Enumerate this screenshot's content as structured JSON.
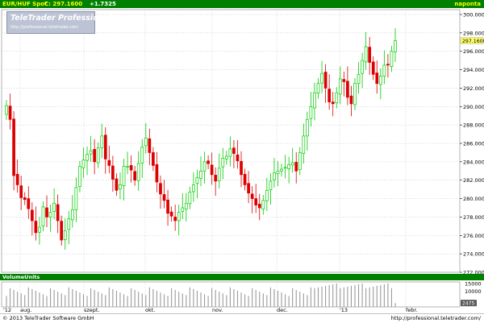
{
  "header": {
    "symbol": "EUR/HUF Spot",
    "close": "C: 297.1600",
    "change": "+1.7325",
    "period": "naponta"
  },
  "watermark": {
    "title": "TeleTrader Professional",
    "url": "http://professional.teletrader.com"
  },
  "volume_panel": {
    "title": "VolumeUnits",
    "ticks": [
      "15000",
      "10000"
    ],
    "last_label": "2475"
  },
  "footer": {
    "copyright": "© 2013 TeleTrader Software GmbH",
    "url": "http://professional.teletrader.com/"
  },
  "colors": {
    "up": "#00cc00",
    "down": "#dd0000",
    "header_bg": "#008000",
    "last_price_tag": "#ffff66",
    "grid": "#b0b0b0"
  },
  "chart_data": {
    "type": "candlestick",
    "title": "EUR/HUF Spot",
    "ylim": [
      272,
      300
    ],
    "yticks": [
      "300.0000",
      "298.0000",
      "296.0000",
      "294.0000",
      "292.0000",
      "290.0000",
      "288.0000",
      "286.0000",
      "284.0000",
      "282.0000",
      "280.0000",
      "278.0000",
      "276.0000",
      "274.0000",
      "272.0000"
    ],
    "last_price_label": "297.1600",
    "x_tick_labels": [
      "'12",
      "aug.",
      "szept.",
      "okt.",
      "nov.",
      "dec.",
      "'13",
      "febr."
    ],
    "grid": true,
    "close_series": [
      290.1,
      288.6,
      282.5,
      281.5,
      280.1,
      279.9,
      278.9,
      277.6,
      276.3,
      276.9,
      279.1,
      278.0,
      278.5,
      279.5,
      277.6,
      275.5,
      276.5,
      277.8,
      278.8,
      281.2,
      283.5,
      284.2,
      284.8,
      285.2,
      284.0,
      285.5,
      286.8,
      284.3,
      283.6,
      282.1,
      280.9,
      281.5,
      283.5,
      283.5,
      283.1,
      282.0,
      283.8,
      285.6,
      286.6,
      285.0,
      283.6,
      281.8,
      280.5,
      279.8,
      278.4,
      278.1,
      277.6,
      278.5,
      279.0,
      279.5,
      280.7,
      281.5,
      282.3,
      283.0,
      284.0,
      283.8,
      282.6,
      281.9,
      283.3,
      284.4,
      284.6,
      285.4,
      284.9,
      284.1,
      282.6,
      281.5,
      280.6,
      280.0,
      279.3,
      279.0,
      279.8,
      280.9,
      281.9,
      282.8,
      283.0,
      283.2,
      283.4,
      283.7,
      283.9,
      283.0,
      285.0,
      286.8,
      288.6,
      290.0,
      291.5,
      292.5,
      293.6,
      292.0,
      290.5,
      290.3,
      291.5,
      293.0,
      292.7,
      291.0,
      290.3,
      292.5,
      293.5,
      295.0,
      296.5,
      294.8,
      293.5,
      292.5,
      293.3,
      294.5,
      294.5,
      296.0,
      297.16
    ],
    "volume_summary": "daily volume bars, roughly 7000-15000, last value 2475"
  }
}
